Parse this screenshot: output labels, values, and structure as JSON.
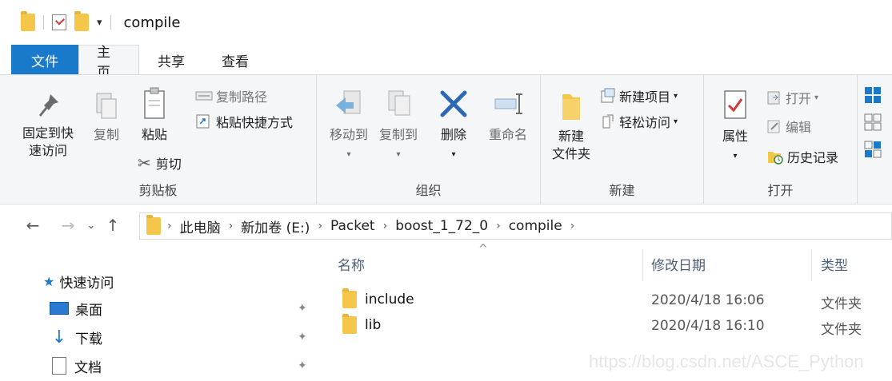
{
  "titlebar": {
    "title": "compile",
    "dropdown": "▾"
  },
  "tabs": [
    {
      "label": "文件"
    },
    {
      "label": "主页"
    },
    {
      "label": "共享"
    },
    {
      "label": "查看"
    }
  ],
  "ribbon": {
    "clipboard": {
      "label": "剪贴板",
      "pin_line1": "固定到快",
      "pin_line2": "速访问",
      "copy": "复制",
      "paste": "粘贴",
      "copy_path": "复制路径",
      "paste_shortcut": "粘贴快捷方式",
      "cut": "剪切"
    },
    "organize": {
      "label": "组织",
      "move_to": "移动到",
      "copy_to": "复制到",
      "delete": "删除",
      "rename": "重命名"
    },
    "new": {
      "label": "新建",
      "new_folder_line1": "新建",
      "new_folder_line2": "文件夹",
      "new_item": "新建项目",
      "easy_access": "轻松访问"
    },
    "open": {
      "label": "打开",
      "properties": "属性",
      "open": "打开",
      "edit": "编辑",
      "history": "历史记录"
    }
  },
  "address": {
    "crumbs": [
      "此电脑",
      "新加卷 (E:)",
      "Packet",
      "boost_1_72_0",
      "compile"
    ]
  },
  "navpane": {
    "items": [
      {
        "label": "快速访问",
        "icon": "star-icon"
      },
      {
        "label": "桌面",
        "icon": "desktop-icon"
      },
      {
        "label": "下载",
        "icon": "download-icon"
      },
      {
        "label": "文档",
        "icon": "document-icon"
      }
    ]
  },
  "filelist": {
    "columns": {
      "name": "名称",
      "date": "修改日期",
      "type": "类型"
    },
    "rows": [
      {
        "name": "include",
        "date": "2020/4/18 16:06",
        "type": "文件夹"
      },
      {
        "name": "lib",
        "date": "2020/4/18 16:10",
        "type": "文件夹"
      }
    ]
  },
  "watermark": "https://blog.csdn.net/ASCE_Python",
  "colors": {
    "accent": "#1979ca",
    "folder": "#f4c74b"
  }
}
